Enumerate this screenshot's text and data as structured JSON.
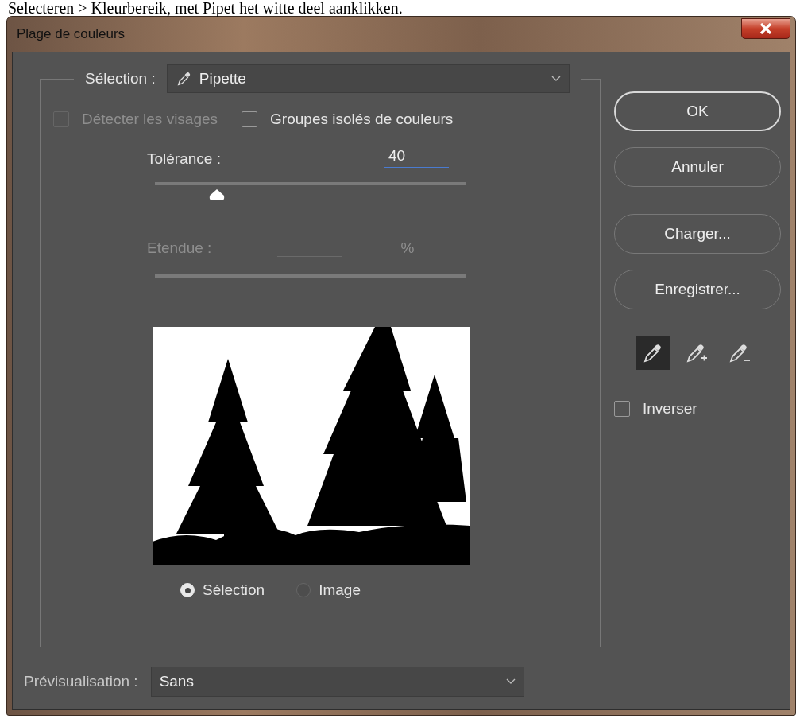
{
  "caption": "Selecteren > Kleurbereik, met Pipet het witte deel aanklikken.",
  "window": {
    "title": "Plage de couleurs"
  },
  "selection": {
    "label": "Sélection :",
    "value": "Pipette"
  },
  "checkboxes": [
    {
      "label": "Détecter les visages",
      "checked": false,
      "disabled": true
    },
    {
      "label": "Groupes isolés de couleurs",
      "checked": false,
      "disabled": false
    }
  ],
  "tolerance": {
    "label": "Tolérance :",
    "value": "40",
    "level": 0.2
  },
  "range": {
    "label": "Etendue :",
    "unit": "%",
    "disabled": true
  },
  "view_options": [
    {
      "label": "Sélection",
      "selected": true
    },
    {
      "label": "Image",
      "selected": false
    }
  ],
  "buttons": [
    {
      "label": "OK",
      "default": true
    },
    {
      "label": "Annuler",
      "default": false
    },
    {
      "label": "Charger...",
      "default": false
    },
    {
      "label": "Enregistrer...",
      "default": false
    }
  ],
  "eyedroppers": [
    {
      "kind": "sample",
      "selected": true
    },
    {
      "kind": "add",
      "selected": false
    },
    {
      "kind": "subtract",
      "selected": false
    }
  ],
  "invert": {
    "label": "Inverser",
    "checked": false
  },
  "preview": {
    "label": "Prévisualisation :",
    "value": "Sans"
  }
}
